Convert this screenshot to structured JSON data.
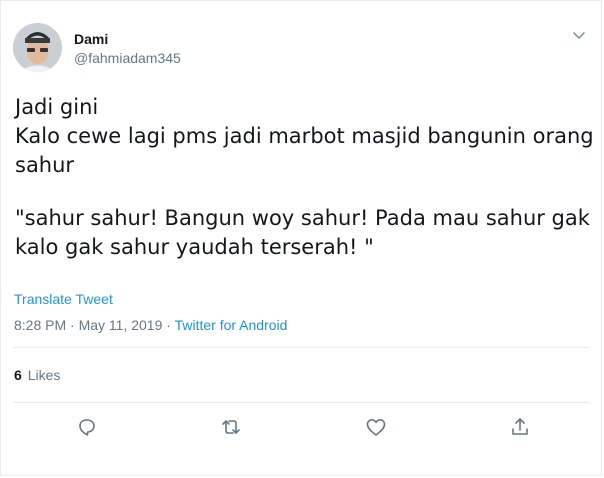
{
  "tweet": {
    "author": {
      "name": "Dami",
      "handle": "@fahmiadam345"
    },
    "text": {
      "line1": "Jadi gini",
      "line2": "Kalo cewe lagi pms jadi marbot masjid bangunin orang sahur",
      "line3": "\"sahur sahur! Bangun woy sahur! Pada mau sahur gak kalo gak sahur yaudah terserah! \""
    },
    "translate_label": "Translate Tweet",
    "meta": {
      "timestamp": "8:28 PM · May 11, 2019",
      "separator": " · ",
      "source": "Twitter for Android"
    },
    "likes": {
      "count": "6",
      "label": "Likes"
    },
    "actions": {
      "reply_icon": "reply-icon",
      "retweet_icon": "retweet-icon",
      "like_icon": "heart-icon",
      "share_icon": "share-icon"
    },
    "colors": {
      "link": "#1b95e0",
      "secondary": "#657786",
      "primary": "#14171a",
      "border": "#e6ecf0"
    }
  }
}
